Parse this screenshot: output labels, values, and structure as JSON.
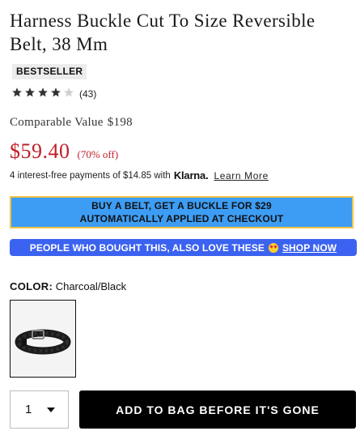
{
  "product": {
    "title": "Harness Buckle Cut To Size Reversible Belt, 38 Mm",
    "badge": "BESTSELLER",
    "rating": {
      "stars": 4,
      "max_stars": 5,
      "count": "(43)"
    },
    "comparable_label": "Comparable Value",
    "comparable_value": "$198",
    "price": "$59.40",
    "discount": "(70% off)",
    "price_color": "#c0202a"
  },
  "klarna": {
    "text": "4 interest-free payments of $14.85 with",
    "logo": "Klarna.",
    "link": "Learn More"
  },
  "promo": {
    "line1": "BUY A BELT, GET A BUCKLE FOR $29",
    "line2": "AUTOMATICALLY APPLIED AT CHECKOUT",
    "bg_color": "#3d9df5",
    "border_color": "#f0c34a"
  },
  "also_love": {
    "text": "PEOPLE WHO BOUGHT THIS, ALSO LOVE THESE",
    "emoji_icon": "heart-eyes-emoji-icon",
    "link": "SHOP NOW",
    "bg_color": "#3b62f0"
  },
  "color": {
    "label": "COLOR:",
    "value": "Charcoal/Black",
    "swatch_icon": "belt-thumbnail-icon"
  },
  "purchase": {
    "quantity": "1",
    "add_label": "ADD TO BAG BEFORE IT'S GONE"
  }
}
